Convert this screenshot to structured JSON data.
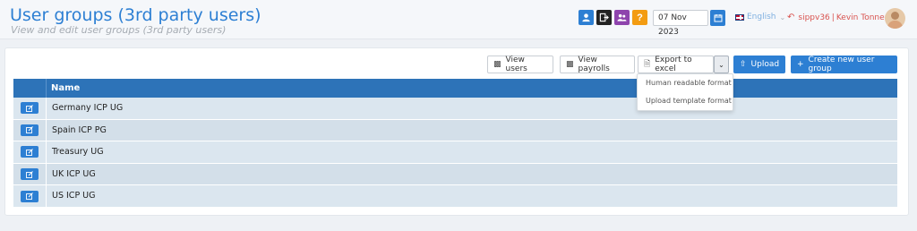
{
  "header": {
    "title": "User groups (3rd party users)",
    "subtitle": "View and edit user groups (3rd party users)",
    "quick_buttons": [
      {
        "icon": "user-icon",
        "color": "#2d7fd3"
      },
      {
        "icon": "export-icon",
        "color": "#222222"
      },
      {
        "icon": "users-icon",
        "color": "#8e44ad"
      },
      {
        "icon": "help-icon",
        "color": "#f39c12",
        "label": "?"
      }
    ],
    "date": "07 Nov 2023",
    "language": "English",
    "user": {
      "account": "sippv36",
      "separator": "|",
      "name": "Kevin Tonner"
    }
  },
  "toolbar": {
    "view_users": "View users",
    "view_payrolls": "View payrolls",
    "export_excel": "Export to excel",
    "upload": "Upload",
    "create_group": "Create new user group"
  },
  "export_menu": {
    "items": [
      "Human readable format",
      "Upload template format"
    ]
  },
  "table": {
    "header": "Name",
    "rows": [
      "Germany ICP UG",
      "Spain ICP PG",
      "Treasury UG",
      "UK ICP UG",
      "US ICP UG"
    ]
  },
  "colors": {
    "accent": "#2d7fd3",
    "header_row": "#2d73b8"
  }
}
